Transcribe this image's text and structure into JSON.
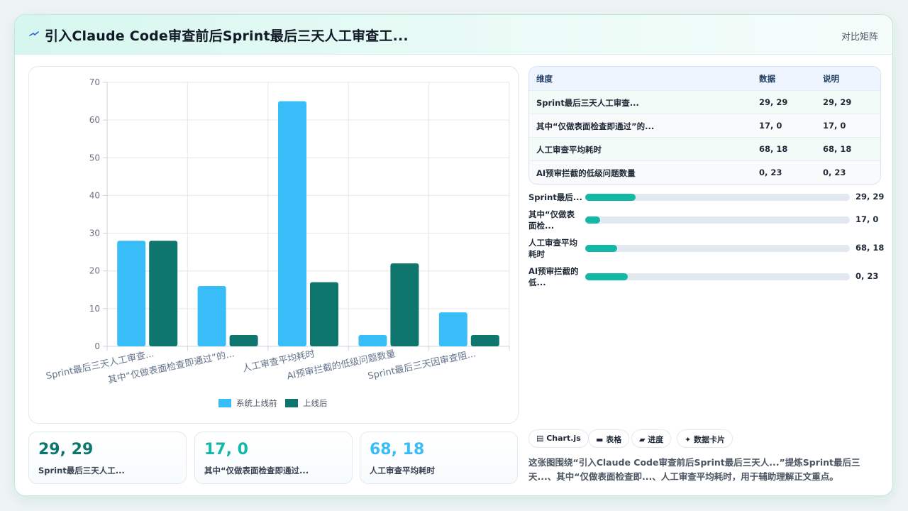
{
  "header": {
    "title": "引入Claude Code审查前后Sprint最后三天人工审查工...",
    "right_label": "对比矩阵",
    "icon": "sparkle-icon"
  },
  "colors": {
    "before": "#38bdf8",
    "after": "#0f766e",
    "progress": "#14b8a6",
    "accent_green": "#0f766e",
    "accent_teal": "#14b8a6",
    "accent_blue": "#38bdf8"
  },
  "chart_data": {
    "type": "bar",
    "categories": [
      "Sprint最后三天人工审查...",
      "其中“仅做表面检查即通过”的...",
      "人工审查平均耗时",
      "AI预审拦截的低级问题数量",
      "Sprint最后三天因审查阻..."
    ],
    "series": [
      {
        "name": "系统上线前",
        "values": [
          28,
          16,
          65,
          3,
          9
        ]
      },
      {
        "name": "上线后",
        "values": [
          28,
          3,
          17,
          22,
          3
        ]
      }
    ],
    "ylim": [
      0,
      70
    ],
    "yticks": [
      0,
      10,
      20,
      30,
      40,
      50,
      60,
      70
    ],
    "grid": true,
    "legend": "bottom"
  },
  "stats": [
    {
      "value": "29, 29",
      "label": "Sprint最后三天人工..."
    },
    {
      "value": "17, 0",
      "label": "其中“仅做表面检查即通过..."
    },
    {
      "value": "68, 18",
      "label": "人工审查平均耗时"
    }
  ],
  "table": {
    "headers": [
      "维度",
      "数据",
      "说明"
    ],
    "rows": [
      [
        "Sprint最后三天人工审查...",
        "29, 29",
        "29, 29"
      ],
      [
        "其中“仅做表面检查即通过”的...",
        "17, 0",
        "17, 0"
      ],
      [
        "人工审查平均耗时",
        "68, 18",
        "68, 18"
      ],
      [
        "AI预审拦截的低级问题数量",
        "0, 23",
        "0, 23"
      ]
    ]
  },
  "progress": [
    {
      "label": "Sprint最后...",
      "value": "29, 29",
      "fraction": 0.19
    },
    {
      "label": "其中“仅做表面检...",
      "value": "17, 0",
      "fraction": 0.055
    },
    {
      "label": "人工审查平均耗时",
      "value": "68, 18",
      "fraction": 0.12
    },
    {
      "label": "AI预审拦截的低...",
      "value": "0, 23",
      "fraction": 0.16
    }
  ],
  "tags": [
    "Chart.js",
    "表格",
    "进度",
    "数据卡片"
  ],
  "description": "这张图围绕“引入Claude Code审查前后Sprint最后三天人...”提炼Sprint最后三天...、其中“仅做表面检查即...、人工审查平均耗时，用于辅助理解正文重点。"
}
